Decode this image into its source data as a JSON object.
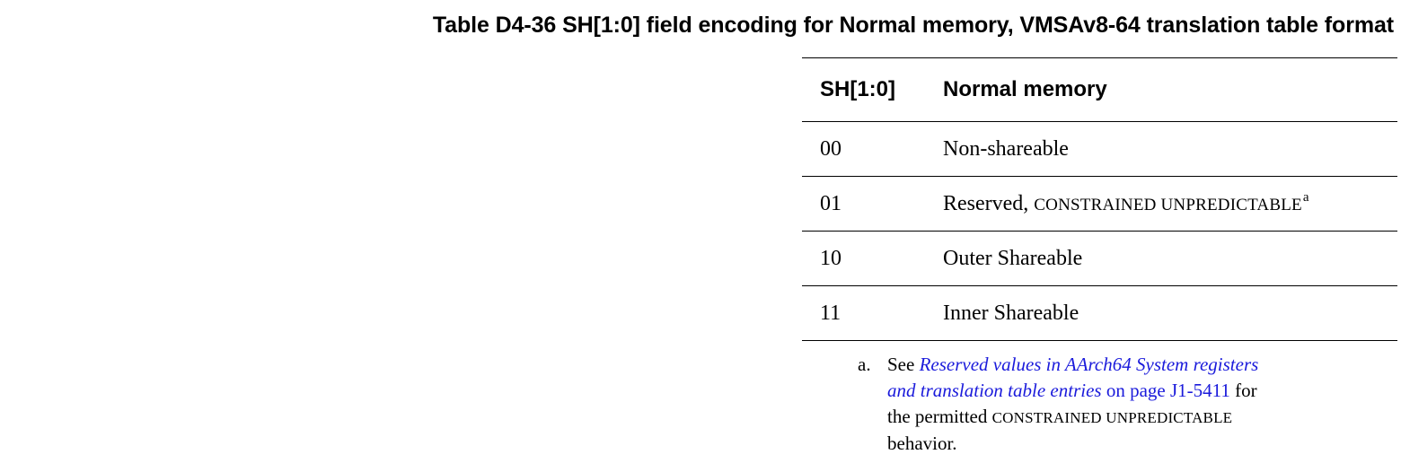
{
  "caption": "Table D4-36 SH[1:0] field encoding for Normal memory, VMSAv8-64 translation table format",
  "table": {
    "headers": [
      "SH[1:0]",
      "Normal memory"
    ],
    "rows": [
      {
        "code": "00",
        "desc": "Non-shareable",
        "desc_sc": "",
        "ref": ""
      },
      {
        "code": "01",
        "desc": "Reserved, ",
        "desc_sc": "CONSTRAINED UNPREDICTABLE",
        "ref": "a"
      },
      {
        "code": "10",
        "desc": "Outer Shareable",
        "desc_sc": "",
        "ref": ""
      },
      {
        "code": "11",
        "desc": "Inner Shareable",
        "desc_sc": "",
        "ref": ""
      }
    ]
  },
  "footnote": {
    "marker": "a.",
    "prefix": "See ",
    "link_line1": "Reserved values in AArch64 System registers",
    "link_line2": "and translation table entries",
    "on_page": " on page ",
    "page_ref": "J1-5411",
    "after_page": " for",
    "line3_prefix": "the permitted ",
    "line3_sc": "CONSTRAINED UNPREDICTABLE",
    "line4": "behavior."
  },
  "colors": {
    "link": "#1a1adb",
    "text": "#000000",
    "background": "#ffffff"
  }
}
